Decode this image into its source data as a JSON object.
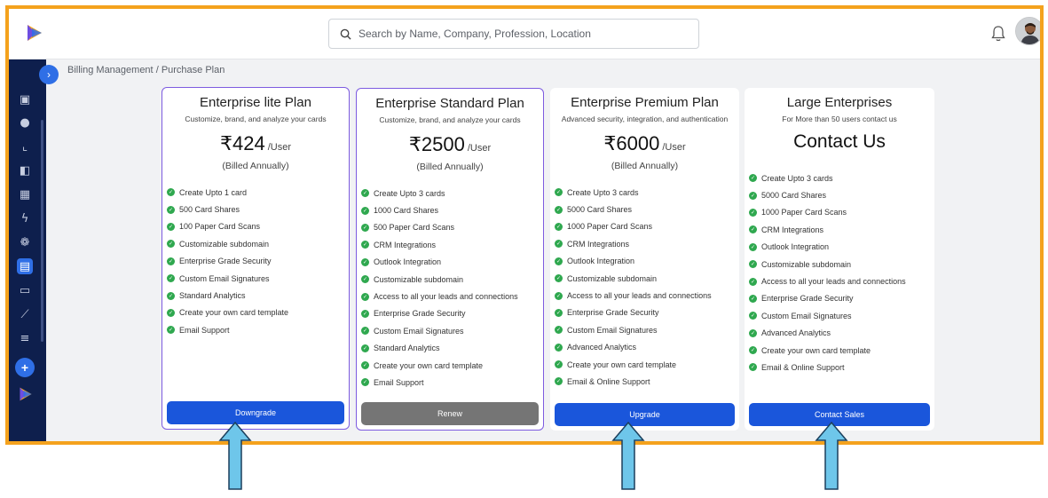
{
  "search": {
    "placeholder": "Search by Name, Company, Profession, Location"
  },
  "breadcrumb": {
    "parent": "Billing Management",
    "separator": "/",
    "current": "Purchase Plan"
  },
  "plans": [
    {
      "title": "Enterprise lite Plan",
      "subtitle": "Customize, brand, and analyze your cards",
      "price": "₹424",
      "unit": "/User",
      "billing": "(Billed Annually)",
      "features": [
        "Create Upto 1 card",
        "500 Card Shares",
        "100 Paper Card Scans",
        "Customizable subdomain",
        "Enterprise Grade Security",
        "Custom Email Signatures",
        "Standard Analytics",
        "Create your own card template",
        "Email Support"
      ],
      "button": "Downgrade"
    },
    {
      "title": "Enterprise Standard Plan",
      "subtitle": "Customize, brand, and analyze your cards",
      "price": "₹2500",
      "unit": "/User",
      "billing": "(Billed Annually)",
      "features": [
        "Create Upto 3 cards",
        "1000 Card Shares",
        "500 Paper Card Scans",
        "CRM Integrations",
        "Outlook Integration",
        "Customizable subdomain",
        "Access to all your leads and connections",
        "Enterprise Grade Security",
        "Custom Email Signatures",
        "Standard Analytics",
        "Create your own card template",
        "Email Support"
      ],
      "button": "Renew"
    },
    {
      "title": "Enterprise Premium Plan",
      "subtitle": "Advanced security, integration, and authentication",
      "price": "₹6000",
      "unit": "/User",
      "billing": "(Billed Annually)",
      "features": [
        "Create Upto 3 cards",
        "5000 Card Shares",
        "1000 Paper Card Scans",
        "CRM Integrations",
        "Outlook Integration",
        "Customizable subdomain",
        "Access to all your leads and connections",
        "Enterprise Grade Security",
        "Custom Email Signatures",
        "Advanced Analytics",
        "Create your own card template",
        "Email & Online Support"
      ],
      "button": "Upgrade"
    },
    {
      "title": "Large Enterprises",
      "subtitle": "For More than 50 users contact us",
      "contact": "Contact Us",
      "features": [
        "Create Upto 3 cards",
        "5000 Card Shares",
        "1000 Paper Card Scans",
        "CRM Integrations",
        "Outlook Integration",
        "Customizable subdomain",
        "Access to all your leads and connections",
        "Enterprise Grade Security",
        "Custom Email Signatures",
        "Advanced Analytics",
        "Create your own card template",
        "Email & Online Support"
      ],
      "button": "Contact Sales"
    }
  ],
  "colors": {
    "frame_border": "#f4a21d",
    "sidebar": "#0e1f4d",
    "primary_button": "#1a56db",
    "renew_button": "#757575",
    "check": "#2fa84f",
    "plan_border": "#7d5be0",
    "annotation_arrow": "#6ec6ea"
  },
  "icons": {
    "sidebar": [
      "contact-card-icon",
      "users-icon",
      "chart-icon",
      "apps-icon",
      "calendar-icon",
      "plug-icon",
      "team-icon",
      "document-icon",
      "id-card-icon",
      "magic-wand-icon",
      "list-settings-icon"
    ]
  }
}
